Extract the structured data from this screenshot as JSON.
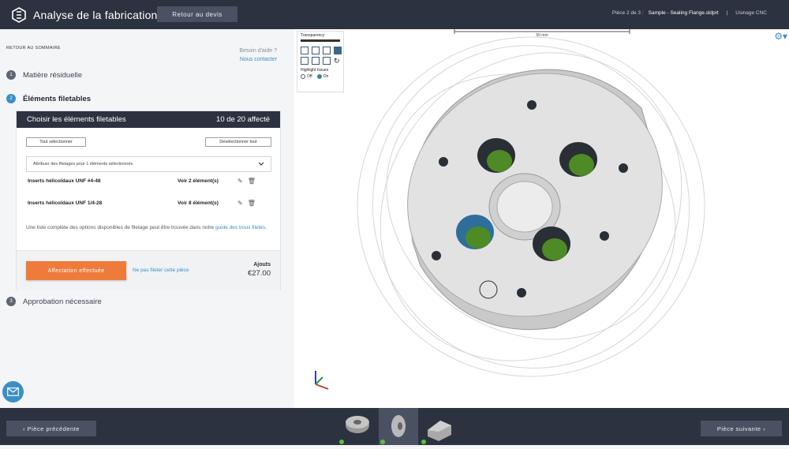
{
  "header": {
    "title": "Analyse de la fabrication",
    "back_label": "Retour au devis",
    "piece_counter": "Pièce 2 de 3 :",
    "filename": "Sample - Sealing Flange.sldprt",
    "separator": "|",
    "process": "Usinage CNC"
  },
  "sidebar": {
    "summary_link": "RETOUR AU SOMMAIRE",
    "help_text": "Besoin d'aide ?",
    "contact_link": "Nous contacter",
    "steps": [
      {
        "num": "1",
        "label": "Matière résiduelle"
      },
      {
        "num": "2",
        "label": "Éléments filetables"
      },
      {
        "num": "3",
        "label": "Approbation nécessaire"
      }
    ]
  },
  "card": {
    "title": "Choisir les éléments filetables",
    "count": "10 de 20 affecté",
    "select_all": "Tout sélectionner",
    "deselect_all": "Désélectionner tout",
    "dropdown": "Attribuer des filetages pour 1 éléments sélectionnés",
    "rows": [
      {
        "name": "Inserts hélicoïdaux UNF #4-48",
        "view": "Voir 2 élément(s)"
      },
      {
        "name": "Inserts hélicoïdaux UNF 1/4-28",
        "view": "Voir 8 élément(s)"
      }
    ],
    "info_text": "Une liste complète des options disponibles de filetage peut être trouvée dans notre ",
    "info_link": "guide des trous filetés",
    "info_end": ".",
    "assign_button": "Affectation effectuée",
    "no_thread_link": "Ne pas fileter cette pièce",
    "addons_label": "Ajouts",
    "addons_price": "€27.00"
  },
  "viewer": {
    "transparency_label": "Transparency",
    "highlight_label": "Highlight Issues",
    "off": "Off",
    "on": "On",
    "scale_label": "50 mm"
  },
  "footer": {
    "prev": "‹ Pièce précédente",
    "next": "Pièce suivante ›"
  },
  "colors": {
    "dark": "#2d3240",
    "accent": "#3a8fc6",
    "orange": "#ee7b3b",
    "green": "#5fbf3f"
  }
}
